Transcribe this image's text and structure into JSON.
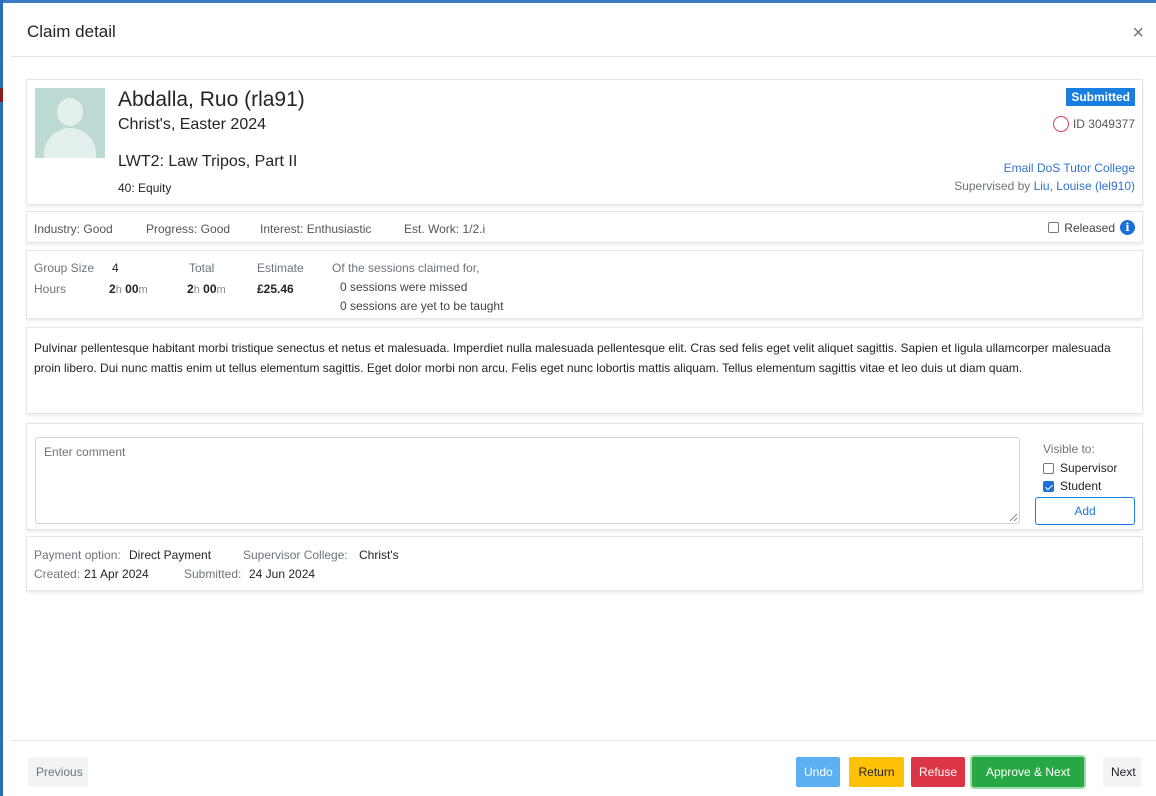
{
  "modal": {
    "title": "Claim detail",
    "close_label": "×"
  },
  "student": {
    "name": "Abdalla, Ruo (rla91)",
    "college_term": "Christ's, Easter 2024",
    "course": "LWT2: Law Tripos, Part II",
    "paper": "40: Equity",
    "status": "Submitted",
    "id_label": "ID 3049377",
    "email_prefix": "Email",
    "email_links": "DoS Tutor College",
    "supervised_prefix": "Supervised by",
    "supervisor": "Liu, Louise (lel910)"
  },
  "assessment": {
    "industry": "Industry: Good",
    "progress": "Progress: Good",
    "interest": "Interest: Enthusiastic",
    "est_work": "Est. Work: 1/2.i",
    "released_label": "Released",
    "released_checked": false
  },
  "sessions": {
    "group_size_label": "Group Size",
    "group_size": "4",
    "hours_label": "Hours",
    "hours_h": "2",
    "hours_m": "00",
    "total_label": "Total",
    "total_h": "2",
    "total_m": "00",
    "estimate_label": "Estimate",
    "estimate": "£25.46",
    "unit_h": "h",
    "unit_m": "m",
    "claimed_heading": "Of the sessions claimed for,",
    "missed": "0 sessions were missed",
    "yet_to_teach": "0 sessions are yet to be taught"
  },
  "notes": "Pulvinar pellentesque habitant morbi tristique senectus et netus et malesuada. Imperdiet nulla malesuada pellentesque elit. Cras sed felis eget velit aliquet sagittis. Sapien et ligula ullamcorper malesuada proin libero. Dui nunc mattis enim ut tellus elementum sagittis. Eget dolor morbi non arcu. Felis eget nunc lobortis mattis aliquam. Tellus elementum sagittis vitae et leo duis ut diam quam.",
  "comment": {
    "placeholder": "Enter comment",
    "visible_to_label": "Visible to:",
    "supervisor_label": "Supervisor",
    "supervisor_checked": false,
    "student_label": "Student",
    "student_checked": true,
    "add_label": "Add"
  },
  "payment": {
    "option_label": "Payment option:",
    "option": "Direct Payment",
    "sup_college_label": "Supervisor College:",
    "sup_college": "Christ's",
    "created_label": "Created:",
    "created": "21 Apr 2024",
    "submitted_label": "Submitted:",
    "submitted": "24 Jun 2024"
  },
  "footer": {
    "previous": "Previous",
    "undo": "Undo",
    "return": "Return",
    "refuse": "Refuse",
    "approve_next": "Approve & Next",
    "next": "Next"
  },
  "colors": {
    "primary": "#1a7de0",
    "warning": "#ffc107",
    "danger": "#dc3545",
    "success": "#28a745",
    "info": "#5ab0f2"
  }
}
